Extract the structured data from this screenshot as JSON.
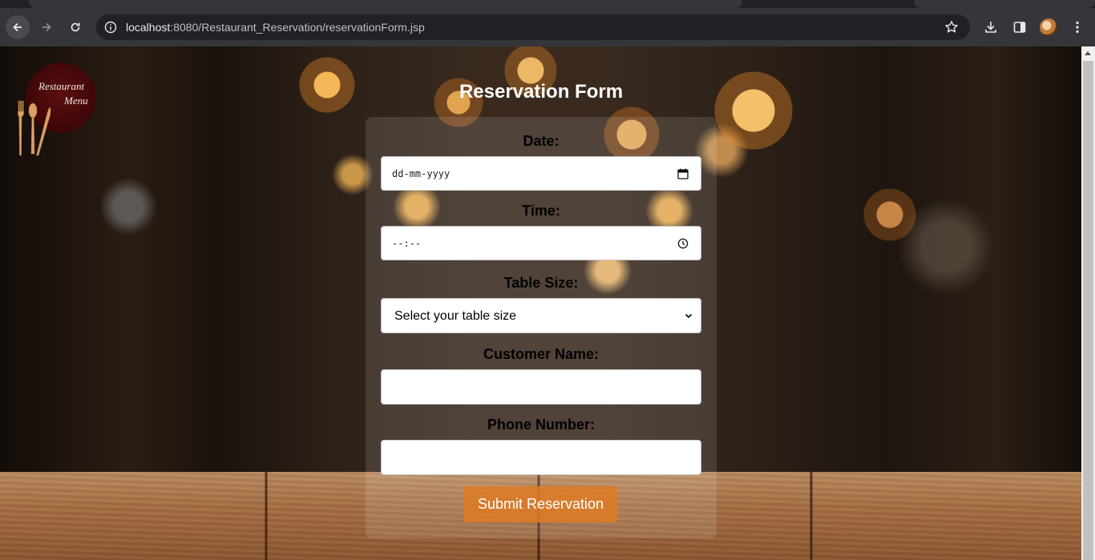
{
  "browser": {
    "url_host": "localhost",
    "url_rest": ":8080/Restaurant_Reservation/reservationForm.jsp",
    "icons": [
      "back-icon",
      "forward-icon",
      "reload-icon",
      "site-info-icon",
      "bookmark-star-icon",
      "download-icon",
      "side-panel-icon",
      "profile-avatar",
      "more-menu-icon"
    ]
  },
  "logo": {
    "line1": "Restaurant",
    "line2": "Menu"
  },
  "form": {
    "title": "Reservation Form",
    "date_label": "Date:",
    "date_placeholder": "dd-mm-yyyy",
    "time_label": "Time:",
    "time_placeholder": "--:--",
    "table_size_label": "Table Size:",
    "table_size_selected": "Select your table size",
    "customer_name_label": "Customer Name:",
    "customer_name_value": "",
    "phone_label": "Phone Number:",
    "phone_value": "",
    "submit_label": "Submit Reservation"
  },
  "colors": {
    "submit_button": "#de7a24",
    "title_text": "#ffffff",
    "label_text": "#000000"
  }
}
